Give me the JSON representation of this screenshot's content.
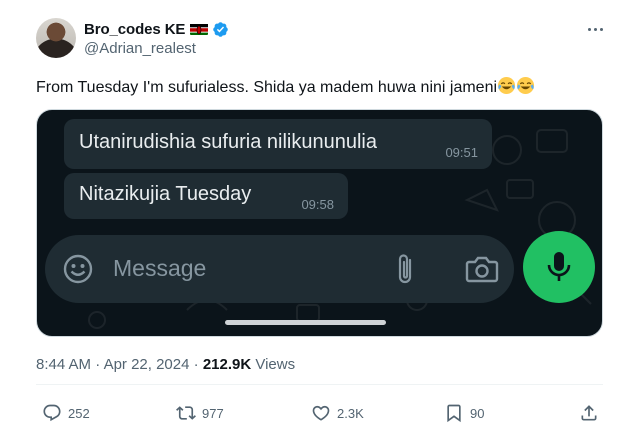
{
  "author": {
    "display_name": "Bro_codes KE",
    "handle": "@Adrian_realest",
    "verified": true,
    "flag_emoji": "kenya-flag-icon"
  },
  "tweet": {
    "text": "From Tuesday I'm sufurialess. Shida ya madem huwa nini jameni",
    "trailing_emojis": [
      "face-with-tears-of-joy-icon",
      "face-with-tears-of-joy-icon"
    ]
  },
  "media": {
    "messages": [
      {
        "text": "Utanirudishia sufuria nilikununulia",
        "time": "09:51"
      },
      {
        "text": "Nitazikujia Tuesday",
        "time": "09:58"
      }
    ],
    "input_placeholder": "Message",
    "colors": {
      "background": "#0b141a",
      "bubble": "#1f2c33",
      "mic": "#21c063"
    }
  },
  "meta": {
    "time": "8:44 AM",
    "date": "Apr 22, 2024",
    "views_count": "212.9K",
    "views_label": "Views"
  },
  "actions": {
    "replies": "252",
    "retweets": "977",
    "likes": "2.3K",
    "bookmarks": "90"
  }
}
